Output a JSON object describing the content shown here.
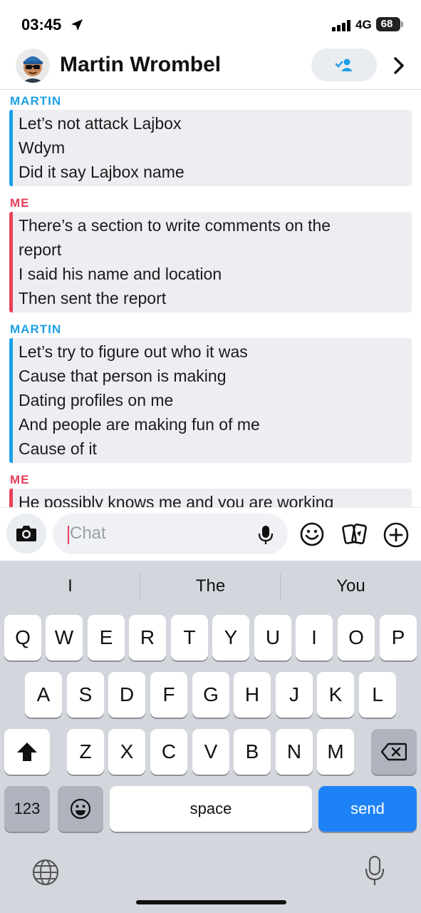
{
  "status_bar": {
    "time": "03:45",
    "network": "4G",
    "battery": "68"
  },
  "header": {
    "contact_name": "Martin Wrombel"
  },
  "messages": [
    {
      "sender": "MARTIN",
      "role": "martin",
      "lines": [
        "Let’s not attack Lajbox",
        "Wdym",
        "Did it say Lajbox name"
      ]
    },
    {
      "sender": "ME",
      "role": "me",
      "lines": [
        "There’s a section to write comments on the",
        "report",
        "I said his name and location",
        "Then sent the report"
      ]
    },
    {
      "sender": "MARTIN",
      "role": "martin",
      "lines": [
        "Let’s try to figure out who it was",
        "Cause that person is making",
        "Dating profiles on me",
        "And people are making fun of me",
        "Cause of it"
      ]
    },
    {
      "sender": "ME",
      "role": "me",
      "lines": [
        "He possibly knows me and you are working"
      ]
    }
  ],
  "input": {
    "placeholder": "Chat"
  },
  "keyboard": {
    "suggestions": [
      "I",
      "The",
      "You"
    ],
    "row1": [
      "Q",
      "W",
      "E",
      "R",
      "T",
      "Y",
      "U",
      "I",
      "O",
      "P"
    ],
    "row2": [
      "A",
      "S",
      "D",
      "F",
      "G",
      "H",
      "J",
      "K",
      "L"
    ],
    "row3": [
      "Z",
      "X",
      "C",
      "V",
      "B",
      "N",
      "M"
    ],
    "numbers_label": "123",
    "space_label": "space",
    "send_label": "send"
  },
  "colors": {
    "martin": "#1ea0e6",
    "me": "#e8405a",
    "send": "#1e82f7"
  }
}
